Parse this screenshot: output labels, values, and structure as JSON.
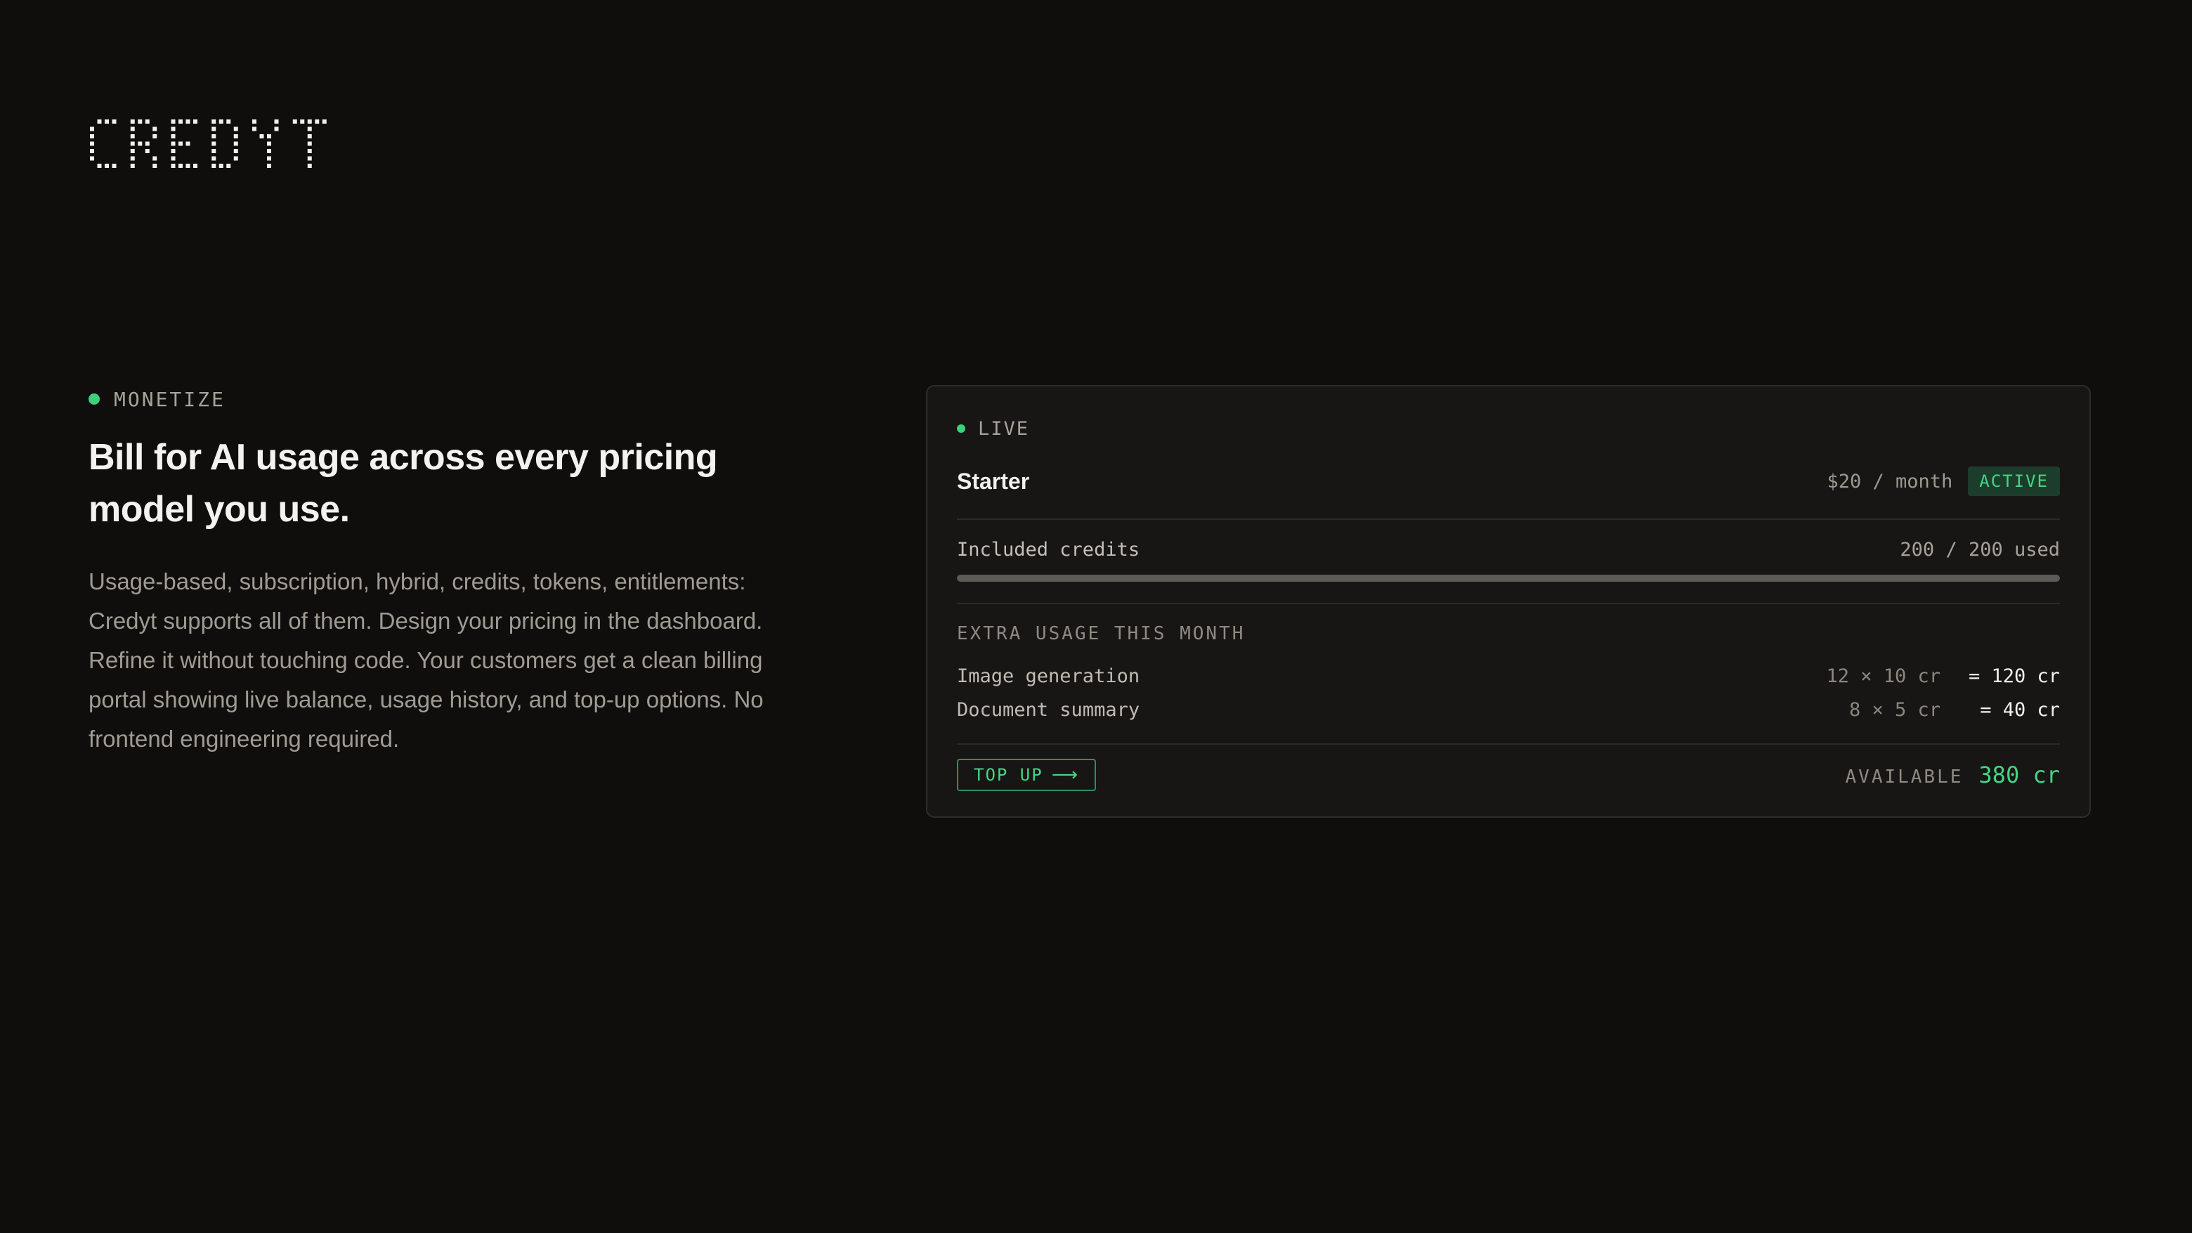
{
  "brand": {
    "logo_text": "CREDYT"
  },
  "intro": {
    "eyebrow": "MONETIZE",
    "headline": "Bill for AI usage across every pricing model you use.",
    "body": "Usage-based, subscription, hybrid, credits, tokens, entitlements: Credyt supports all of them. Design your pricing in the dashboard. Refine it without touching code. Your customers get a clean billing portal showing live balance, usage history, and top-up options. No frontend engineering required."
  },
  "card": {
    "status": "LIVE",
    "plan": {
      "name": "Starter",
      "price": "$20 / month",
      "badge": "ACTIVE"
    },
    "included": {
      "label": "Included credits",
      "value": "200 / 200 used",
      "progress_fraction": 1.0
    },
    "extra": {
      "title": "EXTRA USAGE THIS MONTH",
      "items": [
        {
          "name": "Image generation",
          "expr": "12 × 10 cr",
          "total": "= 120 cr"
        },
        {
          "name": "Document summary",
          "expr": "8 × 5 cr",
          "total": "= 40 cr"
        }
      ]
    },
    "footer": {
      "topup_label": "TOP UP",
      "topup_icon": "arrow-right-icon",
      "available_label": "AVAILABLE",
      "available_value": "380 cr"
    }
  },
  "colors": {
    "background": "#0f0e0d",
    "accent_green": "#45d584",
    "card_bg": "#171615"
  }
}
